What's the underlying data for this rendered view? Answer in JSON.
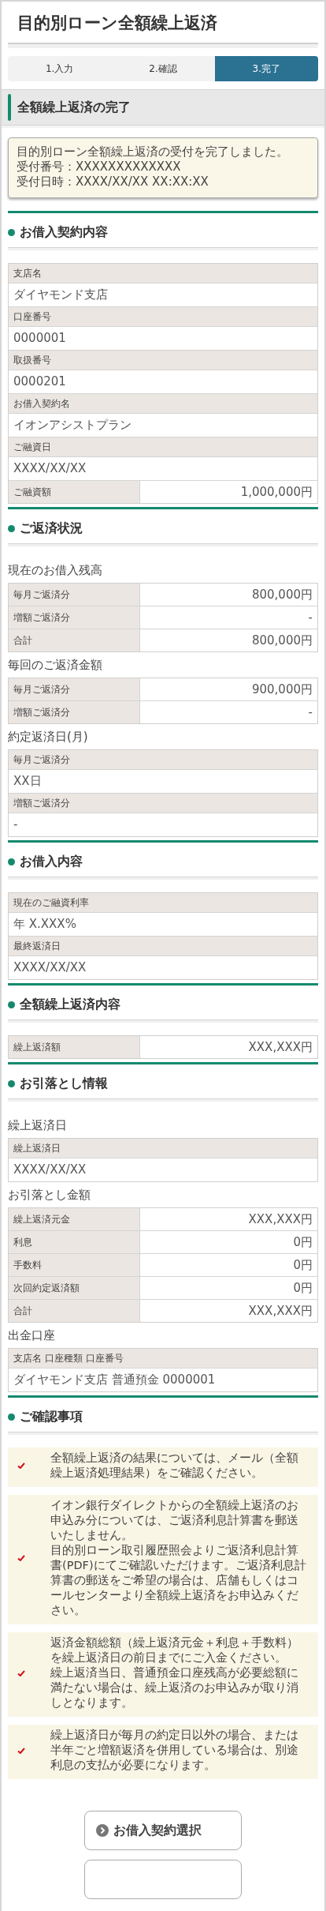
{
  "title": "目的別ローン全額繰上返済",
  "steps": [
    {
      "label": "1.入力",
      "selected": false
    },
    {
      "label": "2.確認",
      "selected": false
    },
    {
      "label": "3.完了",
      "selected": true
    }
  ],
  "banner": "全額繰上返済の完了",
  "notice": [
    "目的別ローン全額繰上返済の受付を完了しました。",
    "受付番号：XXXXXXXXXXXXX",
    "受付日時：XXXX/XX/XX XX:XX:XX"
  ],
  "sections": [
    {
      "title": "お借入契約内容",
      "blocks": [
        {
          "kind": "table",
          "rows": [
            {
              "kind": "stacked",
              "label": "支店名",
              "value": "ダイヤモンド支店"
            },
            {
              "kind": "stacked",
              "label": "口座番号",
              "value": "0000001"
            },
            {
              "kind": "stacked",
              "label": "取扱番号",
              "value": "0000201"
            },
            {
              "kind": "stacked",
              "label": "お借入契約名",
              "value": "イオンアシストプラン"
            },
            {
              "kind": "stacked",
              "label": "ご融資日",
              "value": "XXXX/XX/XX"
            },
            {
              "kind": "split",
              "label": "ご融資額",
              "value": "1,000,000円"
            }
          ]
        }
      ]
    },
    {
      "title": "ご返済状況",
      "blocks": [
        {
          "kind": "subheading",
          "text": "現在のお借入残高"
        },
        {
          "kind": "table",
          "rows": [
            {
              "kind": "split",
              "label": "毎月ご返済分",
              "value": "800,000円"
            },
            {
              "kind": "split",
              "label": "増額ご返済分",
              "value": "-"
            },
            {
              "kind": "split",
              "label": "合計",
              "value": "800,000円"
            }
          ]
        },
        {
          "kind": "subheading",
          "text": "毎回のご返済金額"
        },
        {
          "kind": "table",
          "rows": [
            {
              "kind": "split",
              "label": "毎月ご返済分",
              "value": "900,000円"
            },
            {
              "kind": "split",
              "label": "増額ご返済分",
              "value": "-"
            }
          ]
        },
        {
          "kind": "subheading",
          "text": "約定返済日(月)"
        },
        {
          "kind": "table",
          "rows": [
            {
              "kind": "stacked",
              "label": "毎月ご返済分",
              "value": "XX日"
            },
            {
              "kind": "stacked",
              "label": "増額ご返済分",
              "value": "-"
            }
          ]
        }
      ]
    },
    {
      "title": "お借入内容",
      "blocks": [
        {
          "kind": "table",
          "rows": [
            {
              "kind": "stacked",
              "label": "現在のご融資利率",
              "value": "年 X.XXX%"
            },
            {
              "kind": "stacked",
              "label": "最終返済日",
              "value": "XXXX/XX/XX"
            }
          ]
        }
      ]
    },
    {
      "title": "全額繰上返済内容",
      "blocks": [
        {
          "kind": "table",
          "rows": [
            {
              "kind": "split",
              "label": "繰上返済額",
              "value": "XXX,XXX円"
            }
          ]
        }
      ]
    },
    {
      "title": "お引落とし情報",
      "blocks": [
        {
          "kind": "subheading",
          "text": "繰上返済日"
        },
        {
          "kind": "table",
          "rows": [
            {
              "kind": "stacked",
              "label": "繰上返済日",
              "value": "XXXX/XX/XX"
            }
          ]
        },
        {
          "kind": "subheading",
          "text": "お引落とし金額"
        },
        {
          "kind": "table",
          "rows": [
            {
              "kind": "split",
              "label": "繰上返済元金",
              "value": "XXX,XXX円"
            },
            {
              "kind": "split",
              "label": "利息",
              "value": "0円"
            },
            {
              "kind": "split",
              "label": "手数料",
              "value": "0円"
            },
            {
              "kind": "split",
              "label": "次回約定返済額",
              "value": "0円"
            },
            {
              "kind": "split",
              "label": "合計",
              "value": "XXX,XXX円"
            }
          ]
        },
        {
          "kind": "subheading",
          "text": "出金口座"
        },
        {
          "kind": "table",
          "rows": [
            {
              "kind": "stacked",
              "label": "支店名 口座種類 口座番号",
              "value": "ダイヤモンド支店 普通預金 0000001"
            }
          ]
        }
      ]
    },
    {
      "title": "ご確認事項",
      "blocks": [
        {
          "kind": "notes",
          "items": [
            {
              "lines": [
                "全額繰上返済の結果については、メール（全額繰上返済処理結果）をご確認ください。"
              ]
            },
            {
              "lines": [
                "イオン銀行ダイレクトからの全額繰上返済のお申込み分については、ご返済利息計算書を郵送いたしません。",
                "目的別ローン取引履歴照会よりご返済利息計算書(PDF)にてご確認いただけます。ご返済利息計算書の郵送をご希望の場合は、店舗もしくはコールセンターより全額繰上返済をお申込みください。"
              ]
            },
            {
              "lines": [
                "返済金額総額（繰上返済元金＋利息＋手数料）を繰上返済日の前日までにご入金ください。",
                "繰上返済当日、普通預金口座残高が必要総額に満たない場合は、繰上返済のお申込みが取り消しとなります。"
              ]
            },
            {
              "lines": [
                "繰上返済日が毎月の約定日以外の場合、または半年ごと増額返済を併用している場合は、別途利息の支払が必要になります。"
              ]
            }
          ]
        }
      ]
    }
  ],
  "buttons": [
    {
      "label": "お借入契約選択"
    }
  ]
}
